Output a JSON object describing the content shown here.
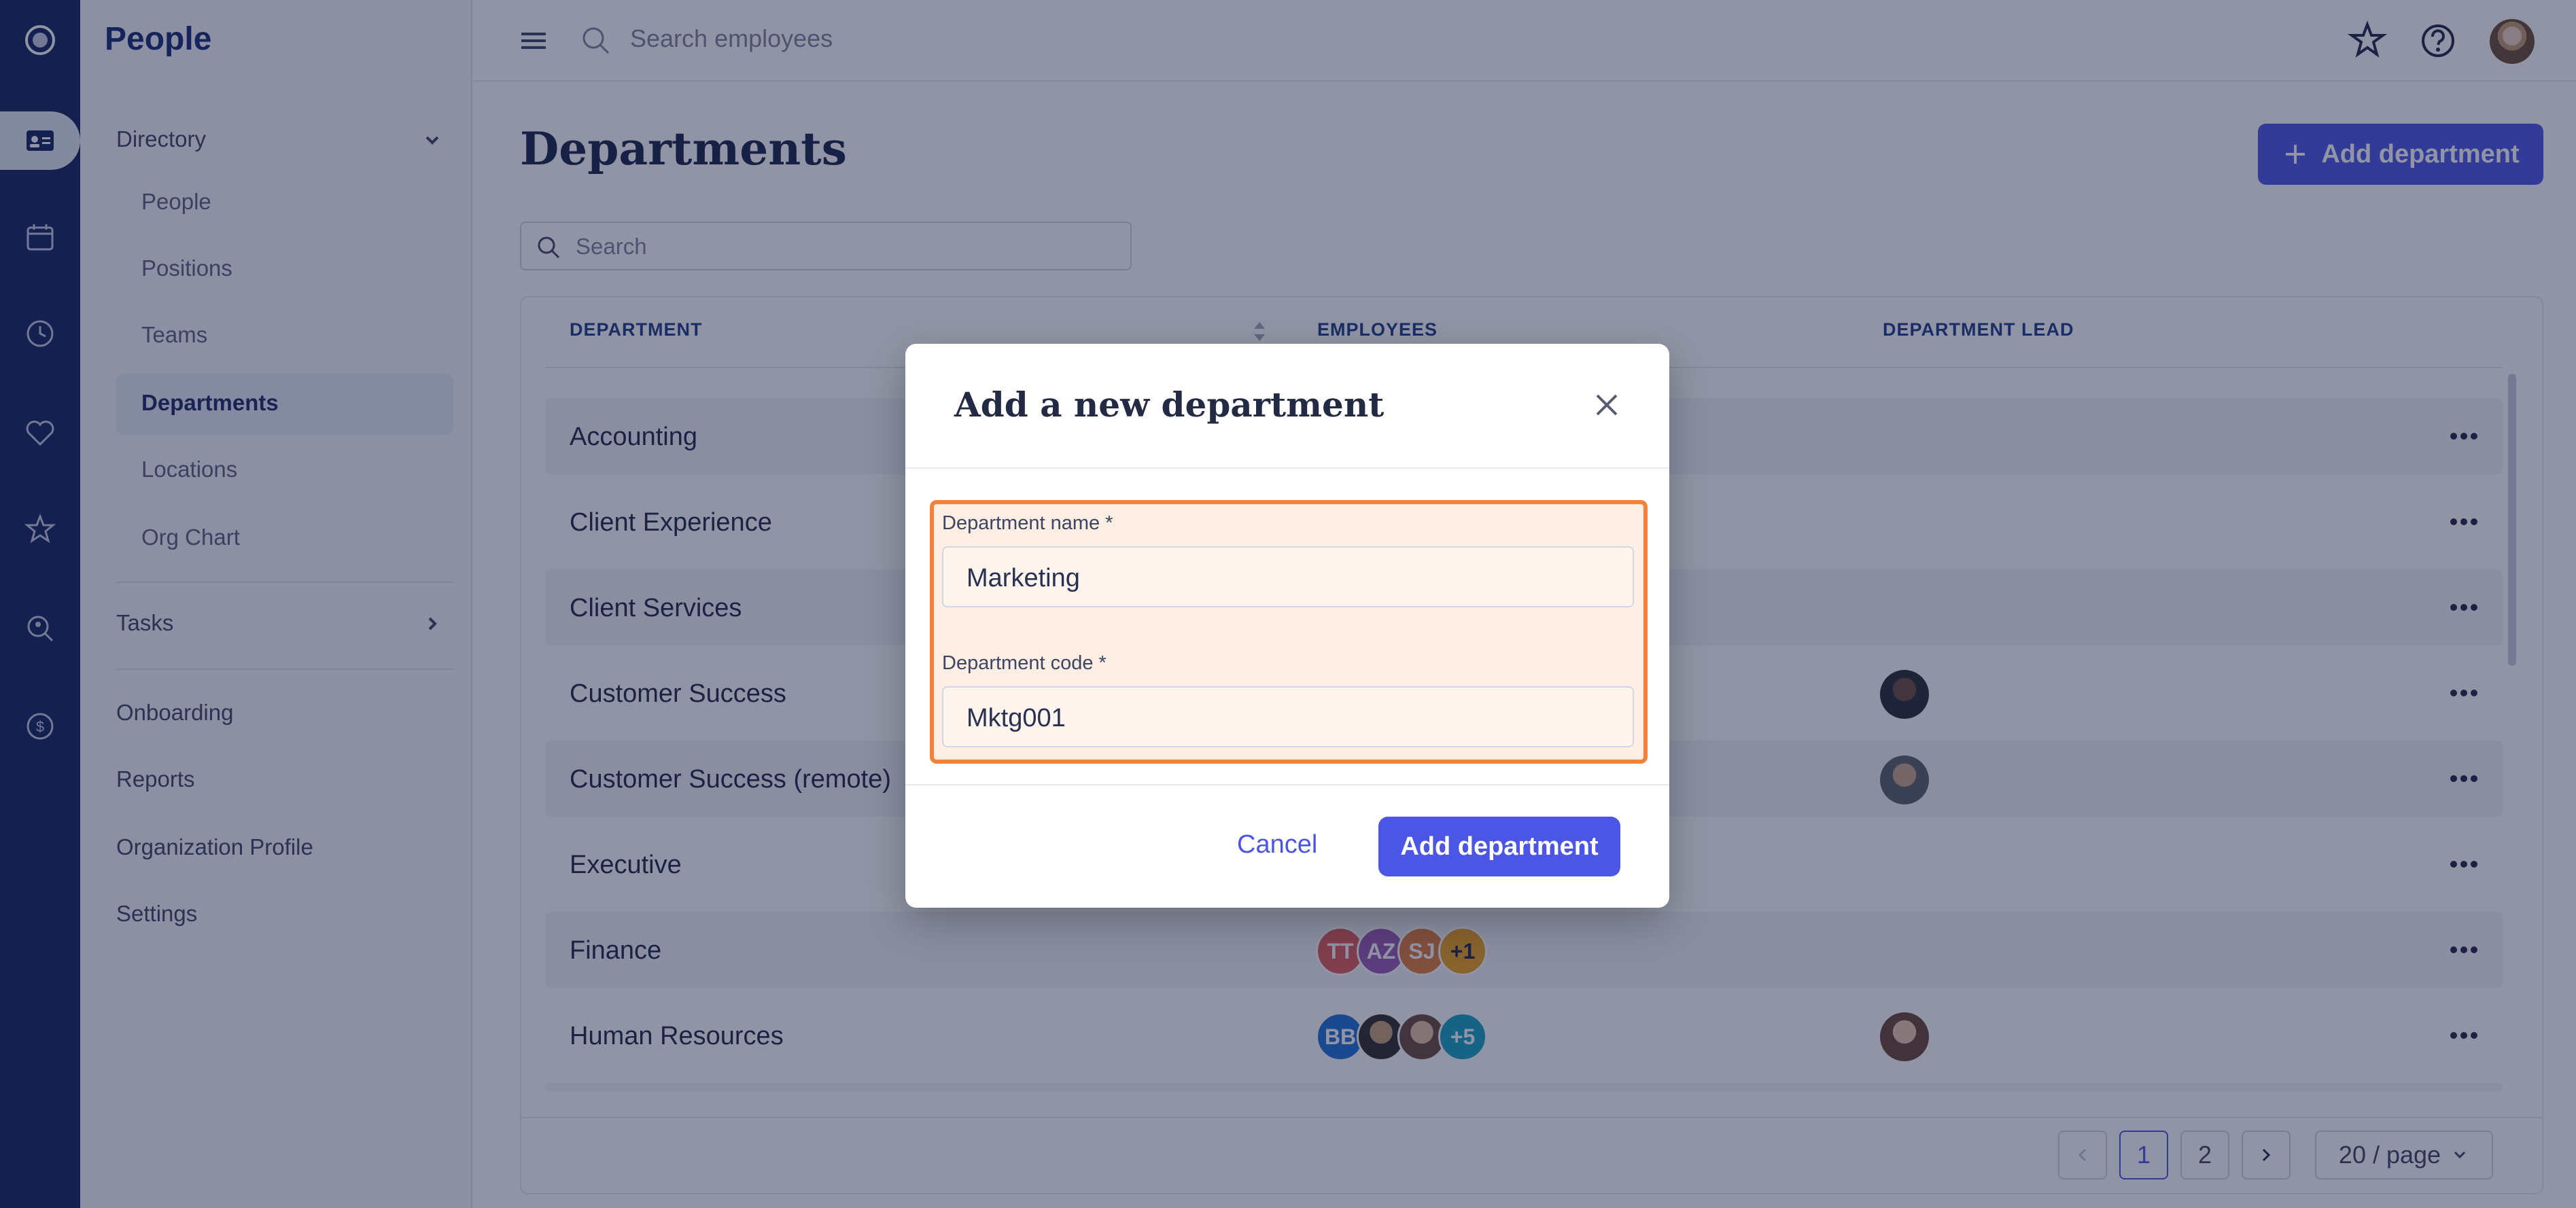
{
  "app": {
    "title": "People"
  },
  "sidebar": {
    "directory_label": "Directory",
    "directory_items": [
      "People",
      "Positions",
      "Teams",
      "Departments",
      "Locations",
      "Org Chart"
    ],
    "tasks_label": "Tasks",
    "other_items": [
      "Onboarding",
      "Reports",
      "Organization Profile",
      "Settings"
    ]
  },
  "header": {
    "search_placeholder": "Search employees"
  },
  "page": {
    "title": "Departments",
    "add_button": "Add department",
    "search_placeholder": "Search"
  },
  "table": {
    "headers": [
      "DEPARTMENT",
      "EMPLOYEES",
      "DEPARTMENT LEAD"
    ],
    "rows": [
      {
        "name": "Accounting"
      },
      {
        "name": "Client Experience"
      },
      {
        "name": "Client Services"
      },
      {
        "name": "Customer Success"
      },
      {
        "name": "Customer Success (remote)"
      },
      {
        "name": "Executive"
      },
      {
        "name": "Finance",
        "employees": [
          "TT",
          "AZ",
          "SJ",
          "+1"
        ]
      },
      {
        "name": "Human Resources",
        "employees": [
          "BB",
          "",
          "",
          "+5"
        ]
      }
    ]
  },
  "pagination": {
    "pages": [
      "1",
      "2"
    ],
    "per_page": "20 / page"
  },
  "modal": {
    "title": "Add a new department",
    "name_label": "Department name",
    "name_value": "Marketing",
    "code_label": "Department code",
    "code_value": "Mktg001",
    "required_mark": "*",
    "cancel": "Cancel",
    "submit": "Add department"
  },
  "colors": {
    "accent": "#4b55e6",
    "rail": "#10215f",
    "highlight_border": "#f0843d"
  }
}
